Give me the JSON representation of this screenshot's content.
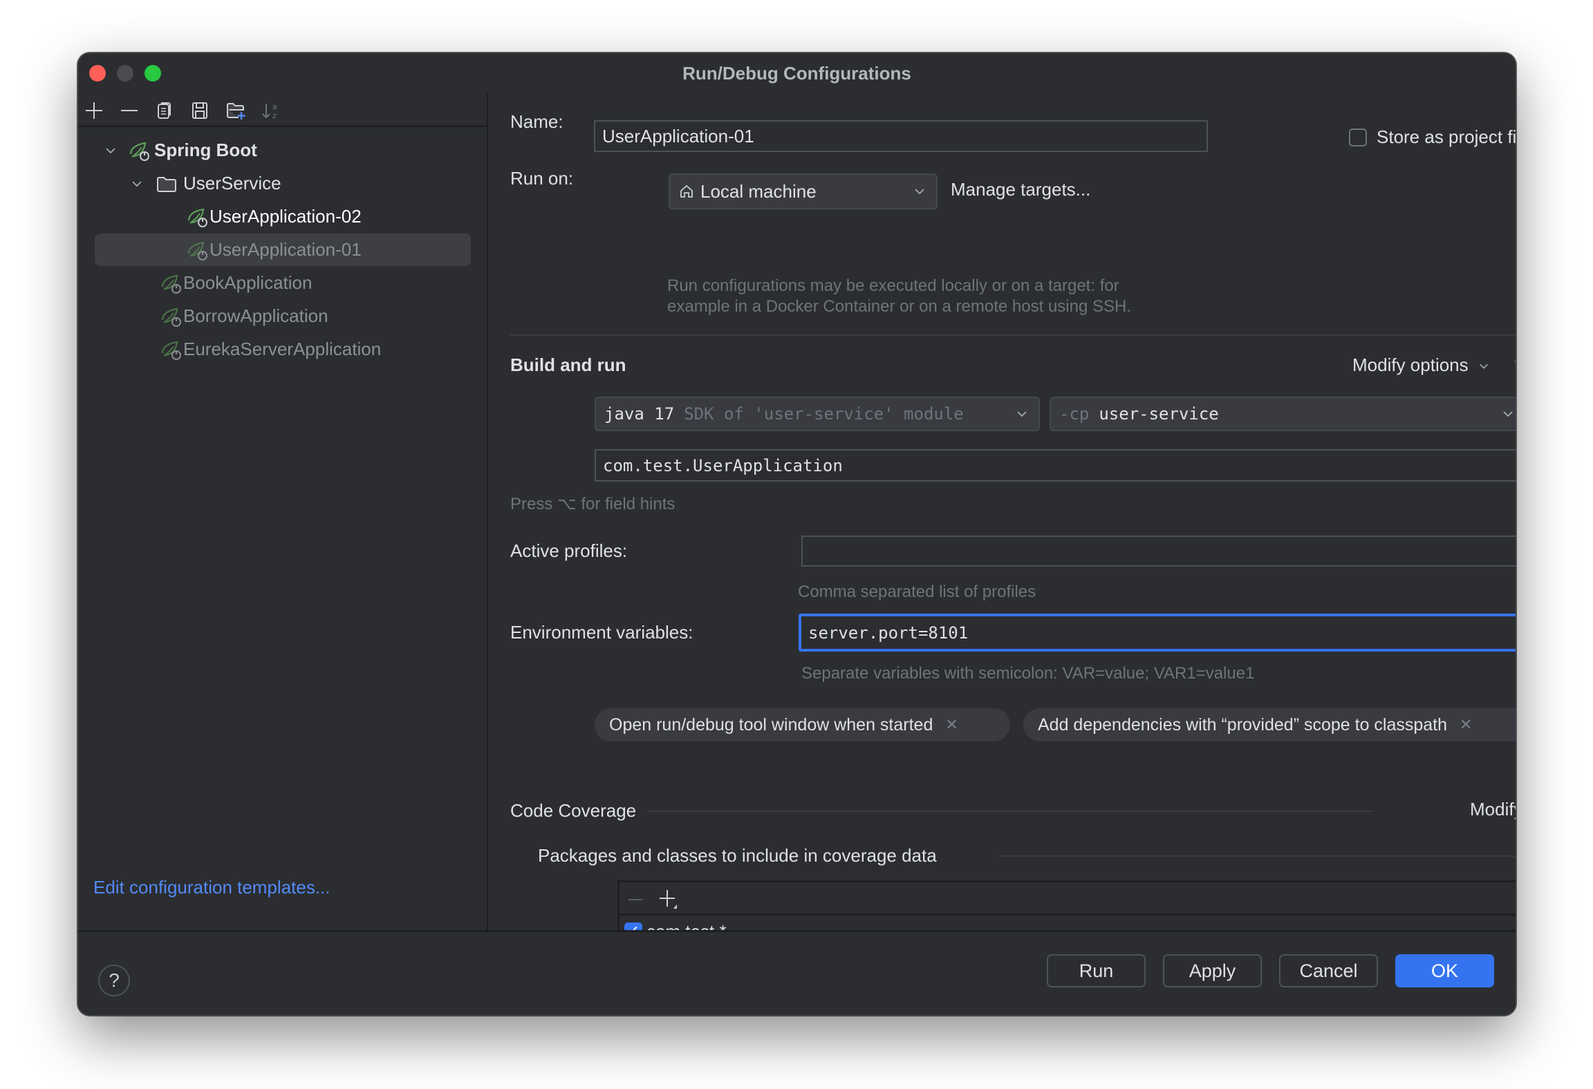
{
  "window": {
    "title": "Run/Debug Configurations"
  },
  "sidebar": {
    "toolbar": [
      {
        "name": "add-icon",
        "tooltip": "Add"
      },
      {
        "name": "remove-icon",
        "tooltip": "Remove"
      },
      {
        "name": "copy-icon",
        "tooltip": "Copy"
      },
      {
        "name": "save-icon",
        "tooltip": "Save"
      },
      {
        "name": "new-folder-icon",
        "tooltip": "New Folder"
      },
      {
        "name": "sort-icon",
        "tooltip": "Sort"
      }
    ],
    "tree": [
      {
        "label": "Spring Boot",
        "level": 0,
        "expanded": true,
        "icon": "spring-boot-icon"
      },
      {
        "label": "UserService",
        "level": 1,
        "expanded": true,
        "icon": "folder-icon"
      },
      {
        "label": "UserApplication-02",
        "level": 2,
        "icon": "spring-boot-icon"
      },
      {
        "label": "UserApplication-01",
        "level": 2,
        "icon": "spring-boot-icon",
        "selected": true
      },
      {
        "label": "BookApplication",
        "level": 1,
        "icon": "spring-boot-icon"
      },
      {
        "label": "BorrowApplication",
        "level": 1,
        "icon": "spring-boot-icon"
      },
      {
        "label": "EurekaServerApplication",
        "level": 1,
        "icon": "spring-boot-icon"
      }
    ],
    "edit_templates_link": "Edit configuration templates..."
  },
  "form": {
    "name_label": "Name:",
    "name_value": "UserApplication-01",
    "store_as_project_file_label": "Store as project file",
    "store_as_project_file_checked": false,
    "run_on_label": "Run on:",
    "run_on_value": "Local machine",
    "manage_targets_link": "Manage targets...",
    "run_on_hint_line1": "Run configurations may be executed locally or on a target: for",
    "run_on_hint_line2": "example in a Docker Container or on a remote host using SSH.",
    "build_and_run": {
      "title": "Build and run",
      "modify_options_link": "Modify options",
      "modify_options_shortcut": "⌥M",
      "jdk_value": "java 17",
      "jdk_hint": "SDK of 'user-service' module",
      "cp_prefix": "-cp",
      "cp_value": "user-service",
      "main_class_value": "com.test.UserApplication",
      "field_hints": "Press ⌥ for field hints"
    },
    "active_profiles_label": "Active profiles:",
    "active_profiles_value": "",
    "active_profiles_hint": "Comma separated list of profiles",
    "env_vars_label": "Environment variables:",
    "env_vars_value": "server.port=8101",
    "env_vars_hint": "Separate variables with semicolon: VAR=value; VAR1=value1",
    "option_chips": [
      "Open run/debug tool window when started",
      "Add dependencies with “provided” scope to classpath"
    ],
    "code_coverage": {
      "title": "Code Coverage",
      "modify_link": "Modify",
      "packages_title": "Packages and classes to include in coverage data",
      "entries": [
        {
          "pattern": "com.test.*",
          "checked": true
        }
      ]
    }
  },
  "footer": {
    "help_label": "?",
    "run_button": "Run",
    "apply_button": "Apply",
    "cancel_button": "Cancel",
    "ok_button": "OK"
  },
  "colors": {
    "accent": "#3574f0",
    "link": "#548af7",
    "spring_green": "#5fa05a",
    "window_bg": "#2b2d30"
  }
}
